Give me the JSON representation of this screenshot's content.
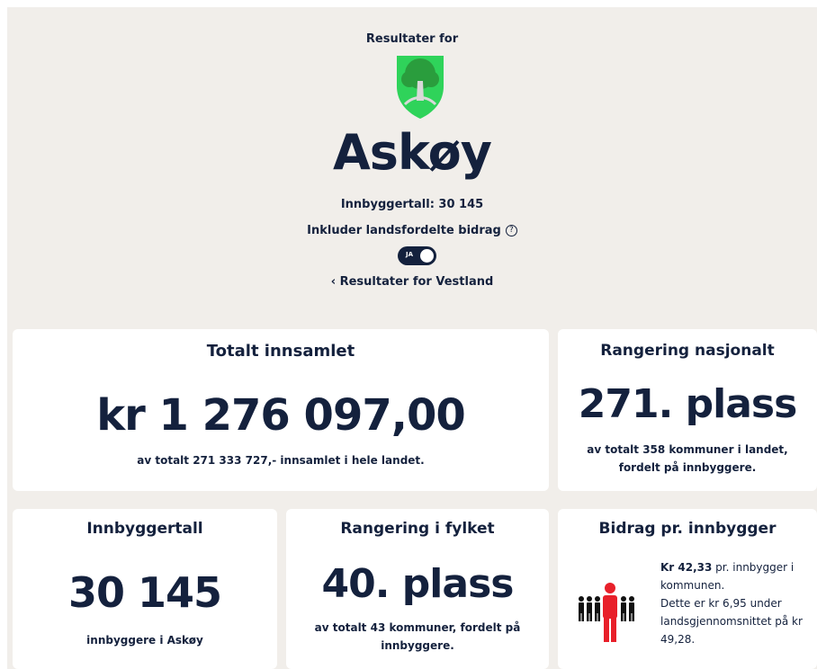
{
  "header": {
    "eyebrow": "Resultater for",
    "municipality": "Askøy",
    "population_line": "Innbyggertall: 30 145",
    "toggle_label": "Inkluder landsfordelte bidrag",
    "toggle_state_text": "JA",
    "toggle_on": true,
    "back_link": "Resultater for Vestland",
    "crest_colors": {
      "shield": "#2fd35a",
      "tree": "#2a9d3d",
      "trunk": "#d9d9d9"
    }
  },
  "cards": {
    "total": {
      "title": "Totalt innsamlet",
      "value": "kr 1 276 097,00",
      "note": "av totalt 271 333 727,- innsamlet i hele landet."
    },
    "national_rank": {
      "title": "Rangering nasjonalt",
      "value": "271. plass",
      "note": "av totalt 358 kommuner i landet, fordelt på innbyggere."
    },
    "population": {
      "title": "Innbyggertall",
      "value": "30 145",
      "note": "innbyggere i Askøy"
    },
    "county_rank": {
      "title": "Rangering i fylket",
      "value": "40. plass",
      "note": "av totalt 43 kommuner, fordelt på innbyggere."
    },
    "per_capita": {
      "title": "Bidrag pr. innbygger",
      "amount": "Kr 42,33",
      "line1_rest": " pr. innbygger i kommunen.",
      "line2": "Dette er kr 6,95 under landsgjennomsnittet på kr 49,28.",
      "highlight_color": "#e8202a",
      "people_color": "#111111"
    }
  }
}
